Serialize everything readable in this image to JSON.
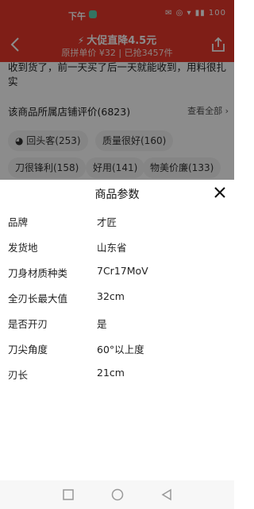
{
  "status_bar": {
    "time": "下午",
    "status_icons": "✉ ◎ ▾ ▮▮ 100"
  },
  "top_bar": {
    "promo_bolt": "⚡",
    "promo": "大促直降4.5元",
    "subline": "原拼单价 ¥32 | 已抢3457件"
  },
  "review": {
    "text": "收到货了，前一天买了后一天就能收到，用料很扎实"
  },
  "shop_reviews": {
    "title": "该商品所属店铺评价(6823)",
    "see_all": "查看全部 ›"
  },
  "tags": [
    "回头客(253)",
    "质量很好(160)",
    "刀很锋利(158)",
    "好用(141)",
    "物美价廉(133)"
  ],
  "sheet": {
    "title": "商品参数",
    "params": [
      {
        "key": "品牌",
        "value": "才匠"
      },
      {
        "key": "发货地",
        "value": "山东省"
      },
      {
        "key": "刀身材质种类",
        "value": "7Cr17MoV"
      },
      {
        "key": "全刃长最大值",
        "value": "32cm"
      },
      {
        "key": "是否开刃",
        "value": "是"
      },
      {
        "key": "刀尖角度",
        "value": "60°以上度"
      },
      {
        "key": "刃长",
        "value": "21cm"
      }
    ]
  },
  "colors": {
    "accent": "#e8382b",
    "tag_bg": "#f3f3f3"
  },
  "icons": {
    "back": "back-arrow-icon",
    "share": "share-icon",
    "close": "close-icon",
    "nav": [
      "square-recents-icon",
      "circle-home-icon",
      "triangle-back-icon"
    ]
  }
}
